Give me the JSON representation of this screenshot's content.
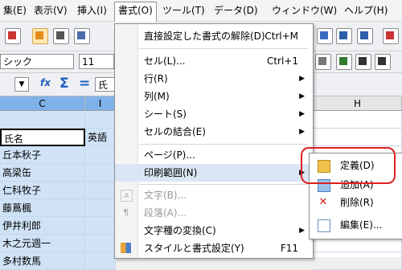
{
  "menubar": {
    "items": [
      "集(E)",
      "表示(V)",
      "挿入(I)",
      "書式(O)",
      "ツール(T)",
      "データ(D)",
      "ウィンドウ(W)",
      "ヘルプ(H)"
    ]
  },
  "toolbar": {
    "font_name": "シック",
    "font_size": "11"
  },
  "formula_bar": {
    "input_value": "氏"
  },
  "grid": {
    "columns": [
      "C",
      "I",
      "H"
    ],
    "rows": [
      [
        "",
        ""
      ],
      [
        "氏名",
        "英語"
      ],
      [
        "丘本秋子",
        ""
      ],
      [
        "高梁缶",
        ""
      ],
      [
        "仁科牧子",
        ""
      ],
      [
        "藤蔦楓",
        ""
      ],
      [
        "伊井利郎",
        ""
      ],
      [
        "木之元週一",
        ""
      ],
      [
        "多村数馬",
        ""
      ]
    ]
  },
  "format_menu": {
    "items": [
      {
        "label": "直接設定した書式の解除(D)",
        "shortcut": "Ctrl+M"
      },
      {
        "label": "セル(L)...",
        "shortcut": "Ctrl+1"
      },
      {
        "label": "行(R)",
        "submenu": true
      },
      {
        "label": "列(M)",
        "submenu": true
      },
      {
        "label": "シート(S)",
        "submenu": true
      },
      {
        "label": "セルの結合(E)",
        "submenu": true
      },
      {
        "label": "ページ(P)..."
      },
      {
        "label": "印刷範囲(N)",
        "submenu": true
      },
      {
        "label": "文字(B)...",
        "disabled": true
      },
      {
        "label": "段落(A)...",
        "disabled": true
      },
      {
        "label": "文字種の変換(C)",
        "submenu": true
      },
      {
        "label": "スタイルと書式設定(Y)",
        "shortcut": "F11"
      }
    ]
  },
  "print_range_submenu": {
    "items": [
      {
        "label": "定義(D)",
        "icon": "define-print-range-icon"
      },
      {
        "label": "追加(A)",
        "icon": "add-print-range-icon"
      },
      {
        "label": "削除(R)",
        "icon": "delete-print-range-icon"
      },
      {
        "label": "編集(E)...",
        "icon": "edit-print-range-icon"
      }
    ]
  },
  "colors": {
    "highlight_ring": "#e02020",
    "selection": "#cfe2f6",
    "menu_hover": "#dbe6f4"
  }
}
